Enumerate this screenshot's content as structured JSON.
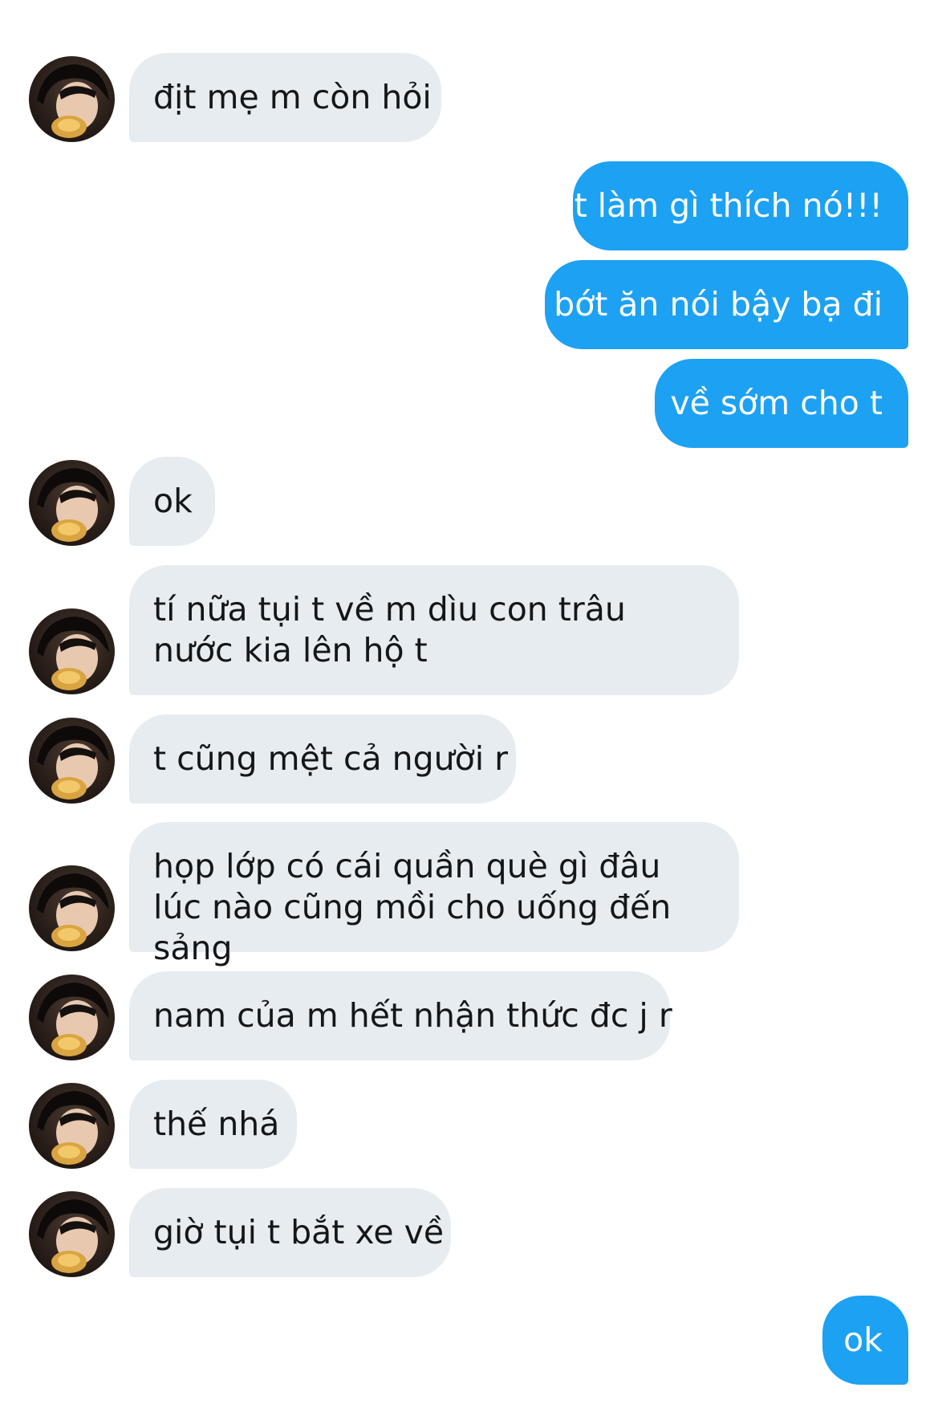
{
  "conversation": {
    "messages": [
      {
        "sender": "other",
        "text": "địt mẹ m còn hỏi"
      },
      {
        "sender": "me",
        "text": "t làm gì thích nó!!!"
      },
      {
        "sender": "me",
        "text": "bớt ăn nói bậy bạ đi"
      },
      {
        "sender": "me",
        "text": "về sớm cho t"
      },
      {
        "sender": "other",
        "text": "ok"
      },
      {
        "sender": "other",
        "text": "tí nữa tụi t về m dìu con trâu nước kia lên hộ t"
      },
      {
        "sender": "other",
        "text": "t cũng mệt cả người r"
      },
      {
        "sender": "other",
        "text": "họp lớp có cái quần què gì đâu lúc nào cũng mồi cho uống đến sảng"
      },
      {
        "sender": "other",
        "text": "nam của m hết nhận thức đc j r"
      },
      {
        "sender": "other",
        "text": "thế nhá"
      },
      {
        "sender": "other",
        "text": "giờ tụi t bắt xe về"
      },
      {
        "sender": "me",
        "text": "ok"
      }
    ]
  },
  "colors": {
    "incoming_bubble": "#e6ecf0",
    "outgoing_bubble": "#1da1f2"
  },
  "icons": {
    "avatar": "profile-photo"
  }
}
